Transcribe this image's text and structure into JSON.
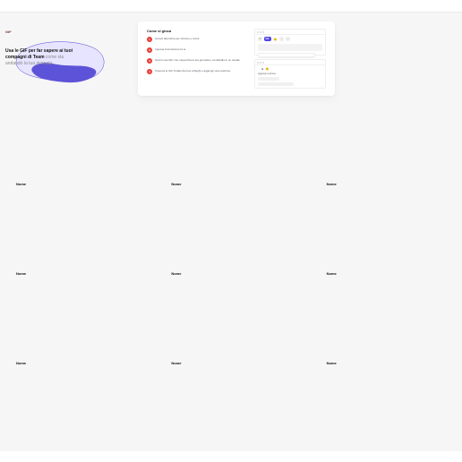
{
  "hero": {
    "pill": "GIF",
    "line1": "Usa le GIF per far sapere ai tuoi",
    "line2_bold": "compagni di Team",
    "line2_rest": " come sta",
    "line3": "andando la tua giornata."
  },
  "card": {
    "title": "Come si gioca",
    "steps": [
      {
        "num": "1",
        "text_html": "Accedi alla barra per scrivere e tocca"
      },
      {
        "num": "2",
        "text_html": "Ingrana l'animazione fa te."
      },
      {
        "num": "3",
        "text_html": "Scopri una GIF, che rispecchia la tua giornata e condividila in un canale."
      },
      {
        "num": "4",
        "text_html": "Osserva le GIF inviate dai tuoi colleghi e aggiungi una reazione."
      }
    ],
    "segment": {
      "gif": "GIF"
    },
    "mini2_label": "Aggiungi reazione"
  },
  "tiles": [
    {
      "label": "Nome"
    },
    {
      "label": "Nome"
    },
    {
      "label": "Nome"
    },
    {
      "label": "Nome"
    },
    {
      "label": "Nome"
    },
    {
      "label": "Nome"
    },
    {
      "label": "Nome"
    },
    {
      "label": "Nome"
    },
    {
      "label": "Nome"
    }
  ]
}
